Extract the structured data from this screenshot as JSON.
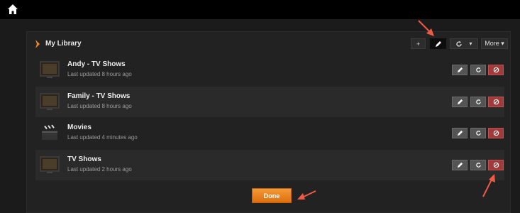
{
  "library": {
    "title": "My Library",
    "toolbar": {
      "add_label": "+",
      "more_label": "More ▾",
      "refresh_caret": "▾"
    },
    "sections": [
      {
        "name": "Andy - TV Shows",
        "updated": "Last updated 8 hours ago",
        "thumb": "tv-icon"
      },
      {
        "name": "Family - TV Shows",
        "updated": "Last updated 8 hours ago",
        "thumb": "tv-icon"
      },
      {
        "name": "Movies",
        "updated": "Last updated 4 minutes ago",
        "thumb": "clapperboard-icon"
      },
      {
        "name": "TV Shows",
        "updated": "Last updated 2 hours ago",
        "thumb": "tv-icon"
      }
    ],
    "done_label": "Done"
  },
  "colors": {
    "accent": "#f08a24",
    "delete": "#a23a3a",
    "annotation_arrow": "#ee5a45"
  }
}
